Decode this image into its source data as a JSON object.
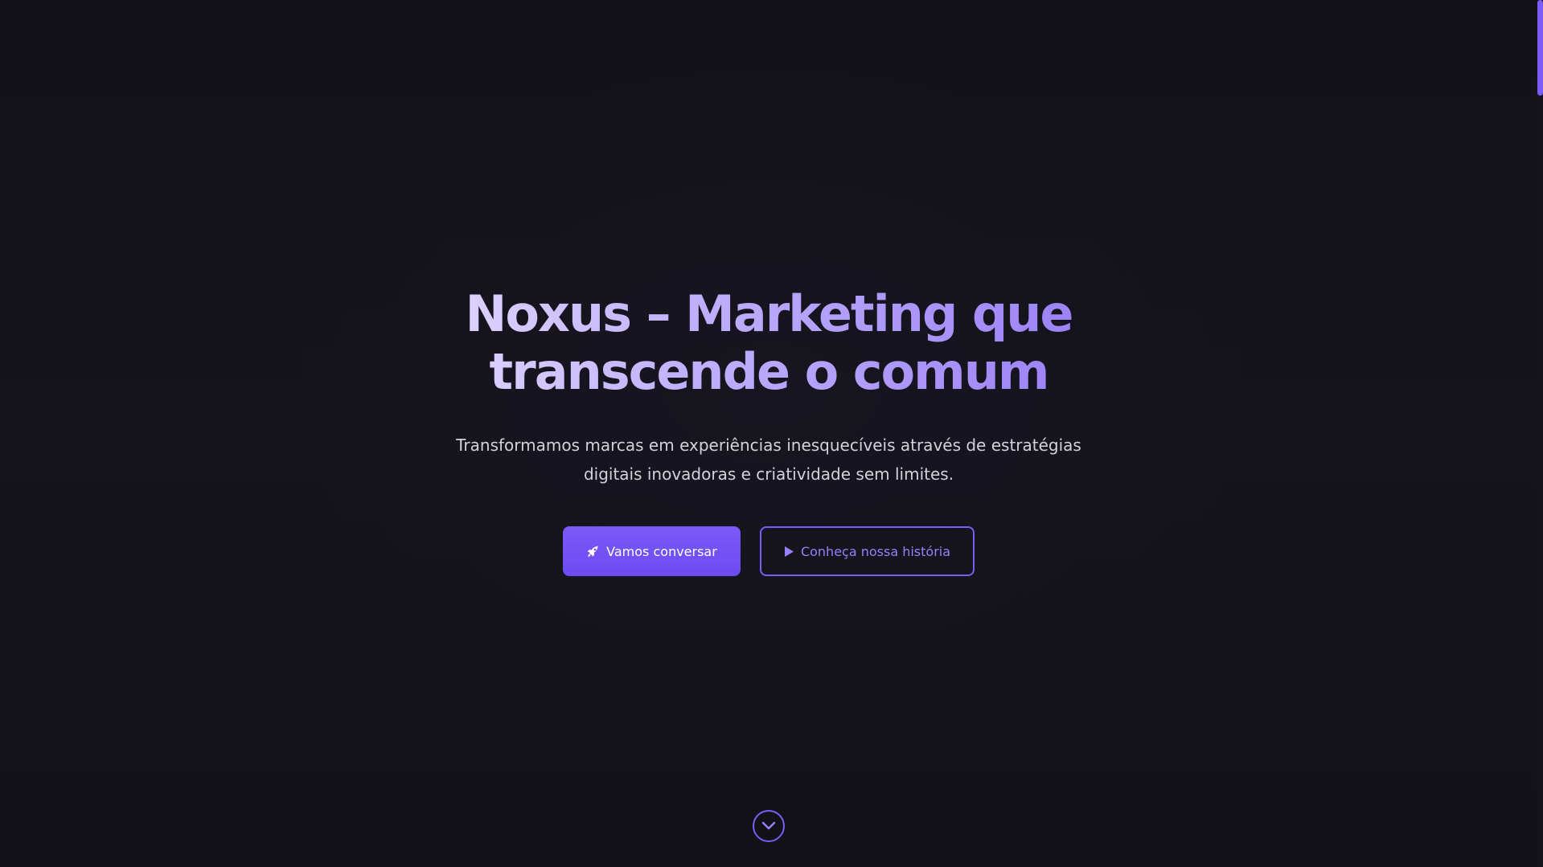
{
  "hero": {
    "title_line1": "Noxus – Marketing que",
    "title_line2": "transcende o comum",
    "subtitle_line1": "Transformamos marcas em experiências inesquecíveis através de estratégias",
    "subtitle_line2": "digitais inovadoras e criatividade sem limites."
  },
  "actions": {
    "primary": {
      "label": "Vamos conversar",
      "icon": "rocket-icon"
    },
    "secondary": {
      "label": "Conheça nossa história",
      "icon": "play-icon"
    }
  },
  "scroll": {
    "icon": "chevron-down-icon"
  },
  "colors": {
    "background": "#131219",
    "accent": "#7b5cf6",
    "accent_light": "#9a7ffb",
    "text_muted": "#d3d1da"
  }
}
